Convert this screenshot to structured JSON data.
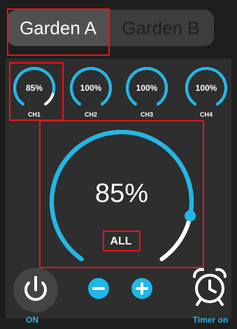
{
  "tabs": {
    "garden_a": "Garden A",
    "garden_b": "Garden B"
  },
  "channels": [
    {
      "label": "CH1",
      "value": "85%",
      "level": 0.85,
      "selected": true
    },
    {
      "label": "CH2",
      "value": "100%",
      "level": 1.0,
      "selected": false
    },
    {
      "label": "CH3",
      "value": "100%",
      "level": 1.0,
      "selected": false
    },
    {
      "label": "CH4",
      "value": "100%",
      "level": 1.0,
      "selected": false
    }
  ],
  "main_dial": {
    "value": "85%",
    "level": 0.85,
    "target": "ALL"
  },
  "controls": {
    "power_label": "ON",
    "timer_label": "Timer on",
    "power_icon": "power-icon",
    "minus_icon": "minus-icon",
    "plus_icon": "plus-icon",
    "timer_icon": "alarm-clock-icon"
  },
  "colors": {
    "accent": "#1fb8e8",
    "track": "#ffffff",
    "highlight": "#e8141b",
    "background": "#1e1e1e"
  }
}
